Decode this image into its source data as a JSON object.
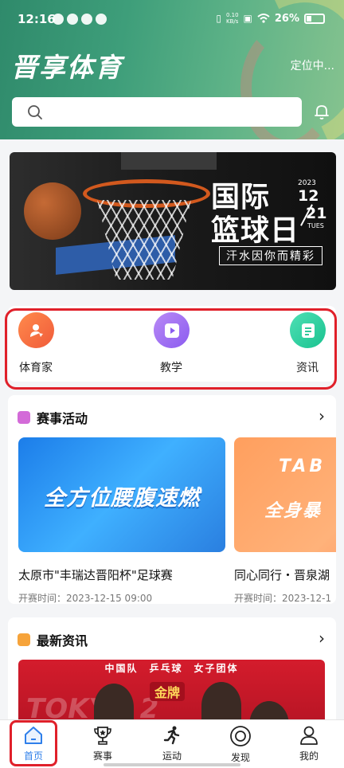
{
  "status_bar": {
    "time": "12:16",
    "net_speed_top": "0.10",
    "net_speed_unit": "KB/s",
    "battery": "26%"
  },
  "header": {
    "brand": "晋享体育",
    "location": "定位中...",
    "search_placeholder": ""
  },
  "banner": {
    "title_line1": "国际",
    "title_line2": "篮球日",
    "year": "2023",
    "month": "12",
    "day": "21",
    "weekday": "TUES",
    "slogan": "汗水因你而精彩"
  },
  "quick_entries": [
    {
      "label": "体育家",
      "icon": "athlete-icon",
      "color": "#f05b3a"
    },
    {
      "label": "教学",
      "icon": "play-video-icon",
      "color": "#8b5cf0"
    },
    {
      "label": "资讯",
      "icon": "news-doc-icon",
      "color": "#19c28f"
    }
  ],
  "events_section": {
    "title": "赛事活动",
    "items": [
      {
        "image_text": "全方位腰腹速燃",
        "name": "太原市\"丰瑞达晋阳杯\"足球赛",
        "time": "开赛时间：2023-12-15 09:00"
      },
      {
        "image_text_1": "TAB",
        "image_text_2": "全身暴",
        "name": "同心同行・晋泉湖",
        "time": "开赛时间：2023-12-1"
      }
    ]
  },
  "news_section": {
    "title": "最新资讯",
    "image_caption": "中国队　乒乓球　女子团体",
    "image_badge": "金牌",
    "image_bg_text": "TOKYO 2"
  },
  "tabbar": {
    "items": [
      {
        "label": "首页",
        "icon": "home-icon",
        "active": true
      },
      {
        "label": "赛事",
        "icon": "trophy-icon",
        "active": false
      },
      {
        "label": "运动",
        "icon": "running-icon",
        "active": false
      },
      {
        "label": "发现",
        "icon": "discover-icon",
        "active": false
      },
      {
        "label": "我的",
        "icon": "profile-icon",
        "active": false
      }
    ]
  },
  "colors": {
    "header_green": "#3e9e7a",
    "accent_blue": "#2f7fea",
    "highlight_red": "#e0202a"
  }
}
